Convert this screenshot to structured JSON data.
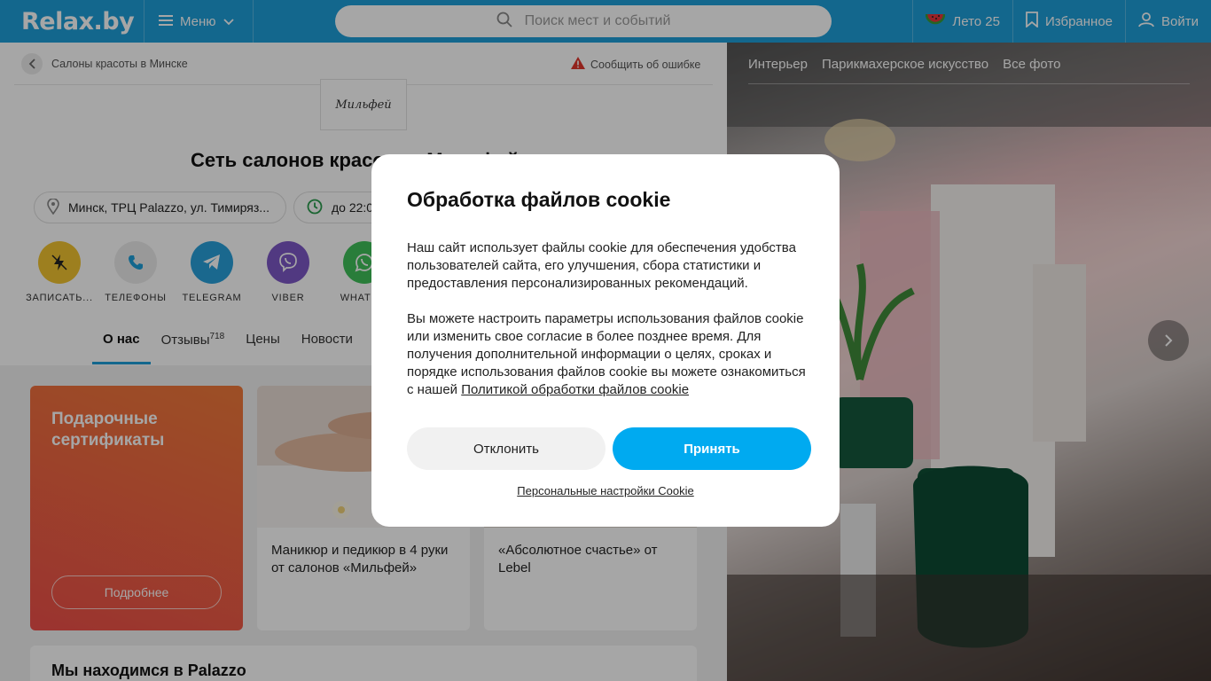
{
  "header": {
    "logo": "Relax.by",
    "menu_label": "Меню",
    "search_placeholder": "Поиск мест и событий",
    "summer_label": "Лето 25",
    "favorites_label": "Избранное",
    "login_label": "Войти"
  },
  "breadcrumb": {
    "label": "Салоны красоты в Минске"
  },
  "report_label": "Сообщить об ошибке",
  "org": {
    "logo_text": "Мильфей",
    "title": "Сеть салонов красоты «Мильфей»",
    "address": "Минск, ТРЦ Palazzo, ул. Тимиряз...",
    "hours": "до 22:00"
  },
  "actions": [
    {
      "label": "ЗАПИСАТЬ...",
      "color": "#f2c431",
      "icon": "lightning-icon"
    },
    {
      "label": "ТЕЛЕФОНЫ",
      "color": "#ececec",
      "icon": "phone-icon"
    },
    {
      "label": "TELEGRAM",
      "color": "#29a0da",
      "icon": "telegram-icon"
    },
    {
      "label": "VIBER",
      "color": "#7d58c6",
      "icon": "viber-icon"
    },
    {
      "label": "WHATS...",
      "color": "#3fc05a",
      "icon": "whatsapp-icon"
    }
  ],
  "tabs": [
    {
      "label": "О нас"
    },
    {
      "label": "Отзывы",
      "count": "718"
    },
    {
      "label": "Цены"
    },
    {
      "label": "Новости"
    }
  ],
  "gift": {
    "title": "Подарочные сертификаты",
    "button": "Подробнее"
  },
  "promos": [
    {
      "text": "Маникюр и педикюр в 4 руки от салонов «Мильфей»"
    },
    {
      "text": "«Абсолютное счастье» от Lebel"
    }
  ],
  "palazzo_title": "Мы находимся в Palazzo",
  "gallery": {
    "tabs": [
      "Интерьер",
      "Парикмахерское искусство",
      "Все фото"
    ]
  },
  "cookie_dialog": {
    "title": "Обработка файлов cookie",
    "paragraph1": "Наш сайт использует файлы cookie для обеспечения удобства пользователей сайта, его улучшения, сбора статистики и предоставления персонализированных рекомендаций.",
    "paragraph2": "Вы можете настроить параметры использования файлов cookie или изменить свое согласие в более позднее время. Для получения дополнительной информации о целях, сроках и порядке использования файлов cookie вы можете ознакомиться с нашей ",
    "policy_link": "Политикой обработки файлов cookie",
    "decline_label": "Отклонить",
    "accept_label": "Принять",
    "settings_link": "Персональные настройки Cookie"
  },
  "colors": {
    "brand": "#1e9fd9",
    "accept": "#00aaf0"
  }
}
